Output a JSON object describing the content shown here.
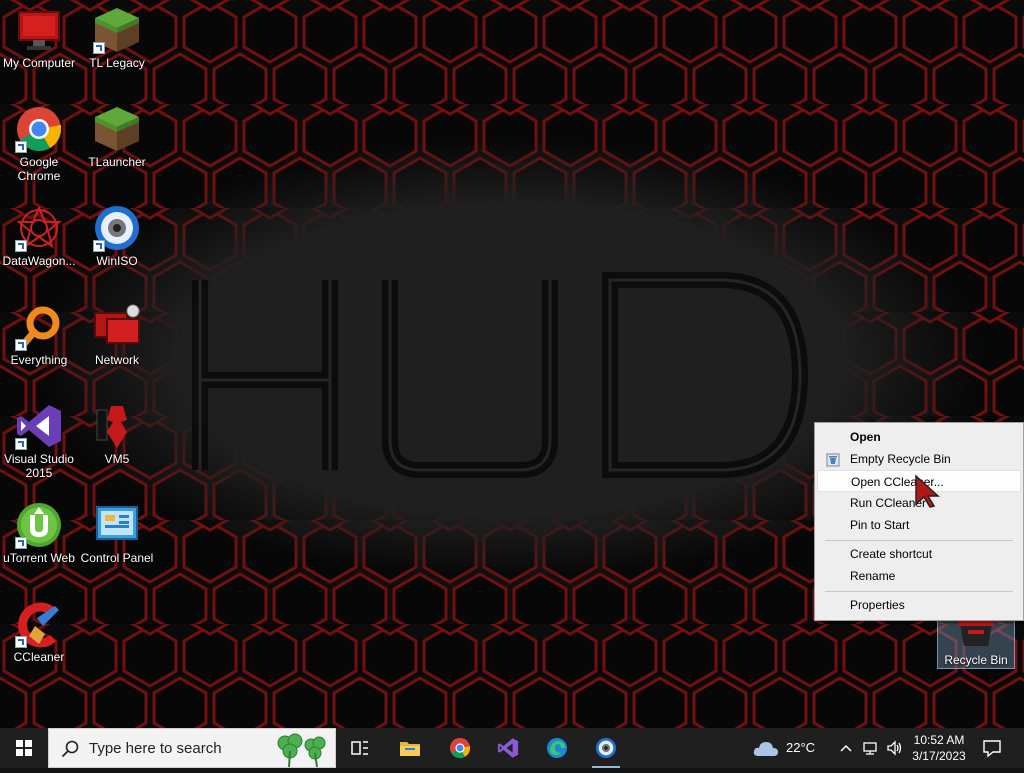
{
  "desktop": {
    "icons": [
      {
        "label": "My Computer",
        "icon": "monitor-icon"
      },
      {
        "label": "TL Legacy",
        "icon": "grass-block-icon"
      },
      {
        "label": "Google Chrome",
        "icon": "chrome-icon"
      },
      {
        "label": "TLauncher",
        "icon": "grass-block-icon"
      },
      {
        "label": "DataWagon...",
        "icon": "datawagon-icon"
      },
      {
        "label": "WinISO",
        "icon": "disc-icon"
      },
      {
        "label": "Everything",
        "icon": "search-ring-icon"
      },
      {
        "label": "Network",
        "icon": "network-icon"
      },
      {
        "label": "Visual Studio 2015",
        "icon": "visual-studio-icon"
      },
      {
        "label": "VM5",
        "icon": "vm5-icon"
      },
      {
        "label": "uTorrent Web",
        "icon": "utorrent-icon"
      },
      {
        "label": "Control Panel",
        "icon": "control-panel-icon"
      },
      {
        "label": "CCleaner",
        "icon": "ccleaner-icon"
      }
    ],
    "recycle_bin": {
      "label": "Recycle Bin"
    },
    "wallpaper_text": "HUD",
    "accent_color": "#c41a1a"
  },
  "context_menu": {
    "items": [
      {
        "label": "Open",
        "bold": true
      },
      {
        "label": "Empty Recycle Bin",
        "icon": "recycle-bin-icon"
      },
      {
        "label": "Open CCleaner...",
        "highlighted": true
      },
      {
        "label": "Run CCleaner"
      },
      {
        "label": "Pin to Start"
      },
      {
        "label": "Create shortcut"
      },
      {
        "label": "Rename"
      },
      {
        "label": "Properties"
      }
    ]
  },
  "taskbar": {
    "search_placeholder": "Type here to search",
    "pinned": [
      "task-view-icon",
      "file-explorer-icon",
      "chrome-icon",
      "visual-studio-icon",
      "edge-icon",
      "winiso-icon"
    ],
    "weather": {
      "temperature": "22°C",
      "icon": "cloud-icon"
    },
    "clock": {
      "time": "10:52 AM",
      "date": "3/17/2023"
    }
  }
}
